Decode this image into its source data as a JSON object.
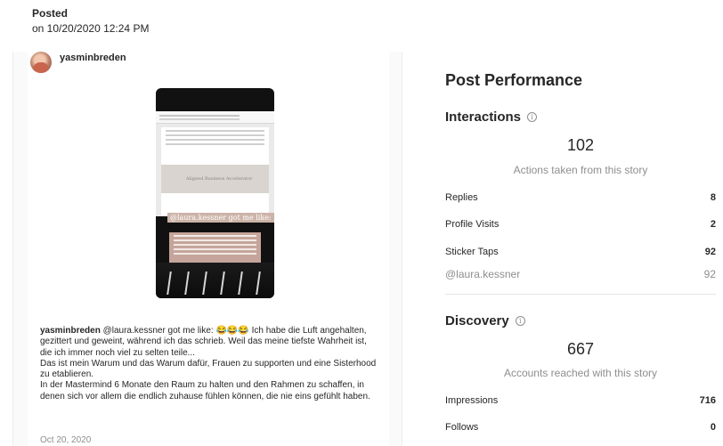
{
  "posted": {
    "title": "Posted",
    "date": "on 10/20/2020 12:24 PM"
  },
  "post": {
    "author": "yasminbreden",
    "story_sticker": "@laura.kessner got me like: 😂😂😂",
    "story_banner": "Aligned Business Accelerator",
    "caption_author": "yasminbreden",
    "caption_text": "@laura.kessner got me like: 😂😂😂 Ich habe die Luft angehalten, gezittert und geweint, während ich das schrieb. Weil das meine tiefste Wahrheit ist, die ich immer noch viel zu selten teile...\nDas ist mein Warum und das Warum dafür, Frauen zu supporten und eine Sisterhood zu etablieren.\nIn der Mastermind 6 Monate den Raum zu halten und den Rahmen zu schaffen, in denen sich vor allem die endlich zuhause fühlen können, die nie eins gefühlt haben.",
    "date": "Oct 20, 2020"
  },
  "performance": {
    "title": "Post Performance",
    "interactions": {
      "title": "Interactions",
      "info_icon": "ⓘ",
      "total": "102",
      "total_label": "Actions taken from this story",
      "rows": [
        {
          "label": "Replies",
          "value": "8"
        },
        {
          "label": "Profile Visits",
          "value": "2"
        },
        {
          "label": "Sticker Taps",
          "value": "92"
        },
        {
          "label": "@laura.kessner",
          "value": "92"
        }
      ]
    },
    "discovery": {
      "title": "Discovery",
      "info_icon": "ⓘ",
      "total": "667",
      "total_label": "Accounts reached with this story",
      "rows": [
        {
          "label": "Impressions",
          "value": "716"
        },
        {
          "label": "Follows",
          "value": "0"
        }
      ]
    }
  }
}
